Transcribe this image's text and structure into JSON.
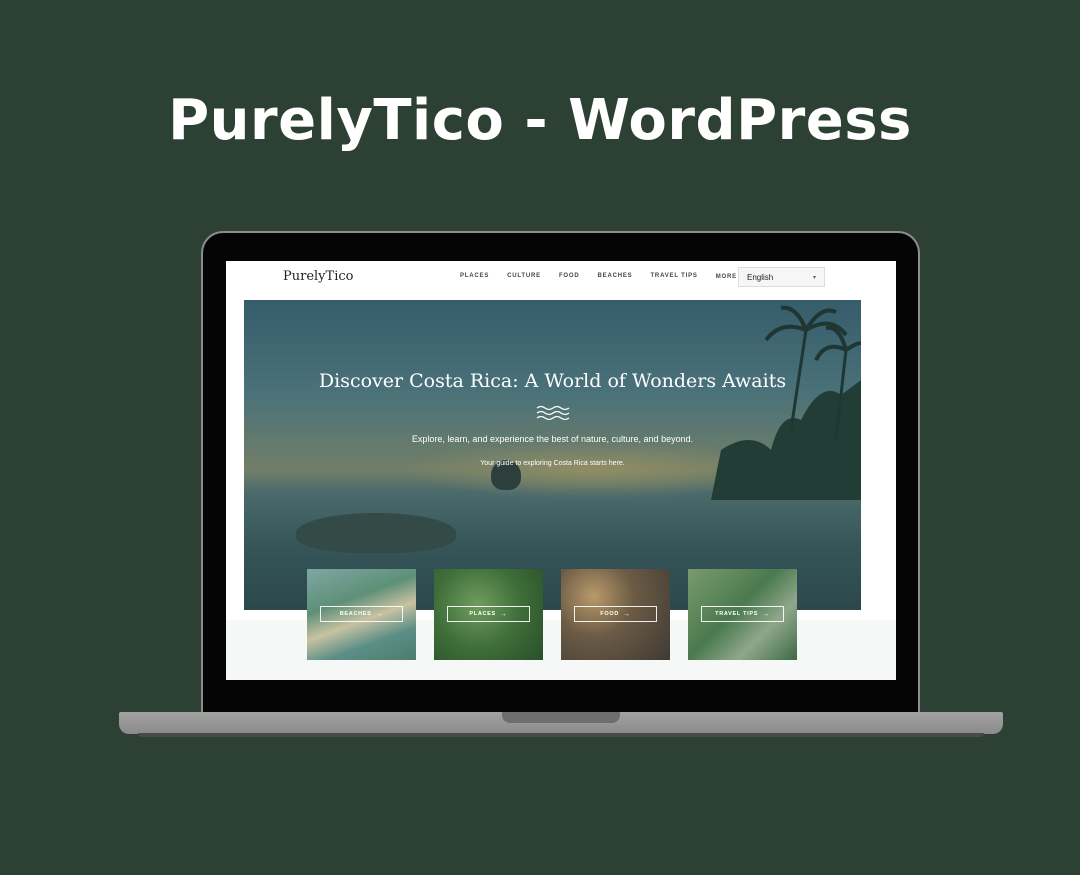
{
  "page_title": "PurelyTico - WordPress",
  "site": {
    "logo": "PurelyTico",
    "nav": [
      "PLACES",
      "CULTURE",
      "FOOD",
      "BEACHES",
      "TRAVEL TIPS",
      "MORE"
    ],
    "language_selected": "English"
  },
  "hero": {
    "title": "Discover Costa Rica: A World of Wonders Awaits",
    "subtitle": "Explore, learn, and experience the best of nature, culture, and beyond.",
    "tagline": "Your guide to exploring Costa Rica starts here."
  },
  "cards": [
    {
      "label": "BEACHES",
      "arrow": "→"
    },
    {
      "label": "PLACES",
      "arrow": "→"
    },
    {
      "label": "FOOD",
      "arrow": "→"
    },
    {
      "label": "TRAVEL TIPS",
      "arrow": "→"
    }
  ],
  "icons": {
    "more_chevron": "chevron-down-icon",
    "lang_chevron": "chevron-down-icon",
    "wave": "wave-icon"
  }
}
